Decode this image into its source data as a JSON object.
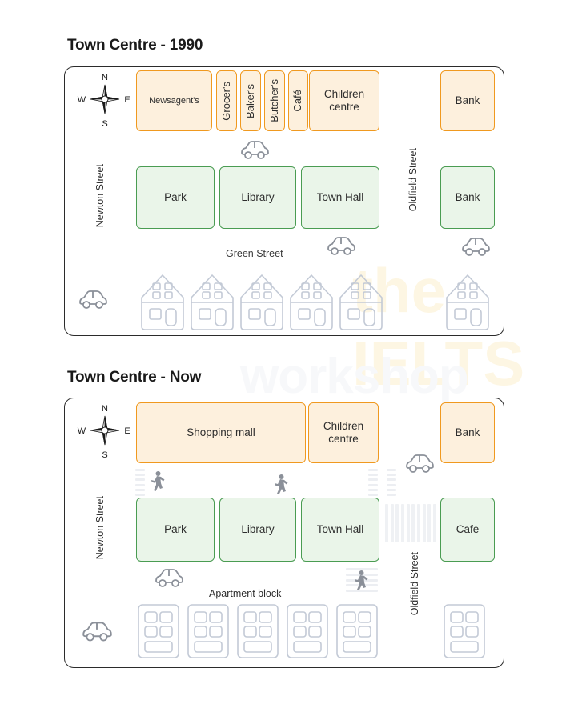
{
  "maps": [
    {
      "title": "Town Centre - 1990",
      "compass": {
        "n": "N",
        "e": "E",
        "s": "S",
        "w": "W"
      },
      "streets": {
        "left": "Newton Street",
        "right": "Oldfield Street",
        "middle": "Green Street"
      },
      "top_row": [
        {
          "label": "Newsagent's",
          "style": "orange",
          "orient": "horizontal"
        },
        {
          "label": "Grocer's",
          "style": "orange",
          "orient": "vertical"
        },
        {
          "label": "Baker's",
          "style": "orange",
          "orient": "vertical"
        },
        {
          "label": "Butcher's",
          "style": "orange",
          "orient": "vertical"
        },
        {
          "label": "Café",
          "style": "orange",
          "orient": "vertical"
        },
        {
          "label": "Children centre",
          "style": "orange",
          "orient": "horizontal"
        },
        {
          "label": "Bank",
          "style": "orange",
          "orient": "horizontal"
        }
      ],
      "mid_row": [
        {
          "label": "Park",
          "style": "green"
        },
        {
          "label": "Library",
          "style": "green"
        },
        {
          "label": "Town Hall",
          "style": "green"
        },
        {
          "label": "Bank",
          "style": "green"
        }
      ],
      "bottom_row_icon": "house-icon",
      "bottom_row_count_left": 5,
      "bottom_row_count_right": 1,
      "cars": 4
    },
    {
      "title": "Town Centre - Now",
      "compass": {
        "n": "N",
        "e": "E",
        "s": "S",
        "w": "W"
      },
      "streets": {
        "left": "Newton Street",
        "right": "Oldfield Street"
      },
      "annotations": {
        "apartment": "Apartment block"
      },
      "top_row": [
        {
          "label": "Shopping mall",
          "style": "orange"
        },
        {
          "label": "Children centre",
          "style": "orange"
        },
        {
          "label": "Bank",
          "style": "orange"
        }
      ],
      "mid_row": [
        {
          "label": "Park",
          "style": "green"
        },
        {
          "label": "Library",
          "style": "green"
        },
        {
          "label": "Town Hall",
          "style": "green"
        },
        {
          "label": "Cafe",
          "style": "green"
        }
      ],
      "bottom_row_icon": "apartment-icon",
      "bottom_row_count_left": 5,
      "bottom_row_count_right": 1,
      "cars": 3,
      "pedestrians": 3,
      "crossings": 4
    }
  ],
  "watermark": {
    "line1": "the IELTS",
    "line2": "workshop"
  },
  "colors": {
    "orange_fill": "#fdf0dd",
    "orange_border": "#f0991f",
    "green_fill": "#eaf5e9",
    "green_border": "#4a9c52",
    "frame_border": "#2b2b2b",
    "icon_gray": "#8b9099",
    "house_gray": "#c3cad6"
  }
}
